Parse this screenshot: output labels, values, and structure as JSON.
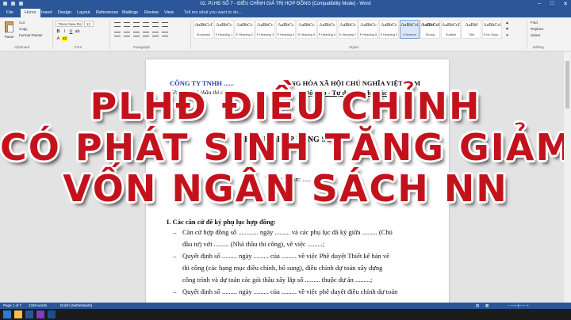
{
  "window": {
    "title": "02. PLHĐ SỐ 7 - ĐIỀU CHỈNH GIÁ TRỊ HỢP ĐỒNG [Compatibility Mode] - Word"
  },
  "ribbon_tabs": [
    "File",
    "Home",
    "Insert",
    "Design",
    "Layout",
    "References",
    "Mailings",
    "Review",
    "View"
  ],
  "active_tab": "Home",
  "tell_me": "Tell me what you want to do...",
  "clipboard": {
    "paste": "Paste",
    "cut": "Cut",
    "copy": "Copy",
    "format_painter": "Format Painter",
    "group": "Clipboard"
  },
  "font": {
    "name": "Times New Ro",
    "size": "12",
    "group": "Font"
  },
  "paragraph": {
    "group": "Paragraph"
  },
  "styles": {
    "group": "Styles",
    "items": [
      {
        "sample": "AaBbCcI",
        "name": "Emphasis"
      },
      {
        "sample": "AaBbCc",
        "name": "¶ Heading 1"
      },
      {
        "sample": "AaBbCc",
        "name": "¶ Heading 2"
      },
      {
        "sample": "AaBbCc",
        "name": "¶ Heading 3"
      },
      {
        "sample": "AaBbCc",
        "name": "¶ Heading 4"
      },
      {
        "sample": "AaBbCc",
        "name": "¶ Heading 5"
      },
      {
        "sample": "AaBbCc",
        "name": "¶ Heading 6"
      },
      {
        "sample": "AaBbCc",
        "name": "¶ Heading 7"
      },
      {
        "sample": "AaBbCc",
        "name": "¶ Heading 8"
      },
      {
        "sample": "AaBbCc",
        "name": "¶ Heading 9"
      },
      {
        "sample": "AaBbCcl",
        "name": "¶ Normal"
      },
      {
        "sample": "AaBbCcI",
        "name": "Strong"
      },
      {
        "sample": "AaBbCcD",
        "name": "Subtitle"
      },
      {
        "sample": "AaBbI",
        "name": "Title"
      },
      {
        "sample": "AaBbCcl",
        "name": "¶ No Spac..."
      }
    ]
  },
  "editing": {
    "find": "Find",
    "replace": "Replace",
    "select": "Select",
    "group": "Editing"
  },
  "document": {
    "company": "CÔNG TY TNHH ......",
    "company_sub": "(Ghi tên Nhà thầu thi công)",
    "nation": "CỘNG HÒA XÃ HỘI CHỦ NGHĨA VIỆT NAM",
    "motto": "Độc lập - Tự do - Hạnh phúc",
    "annex_title_prefix": "PHỤ LỤC HỢP ĐỒNG SỐ",
    "annex_number": "01",
    "project_line": "Thuộc dự án: .....",
    "section_heading": "I. Các căn cứ để ký phụ lục hợp đồng:",
    "lines": [
      {
        "lead": "–",
        "text": "Căn cứ hợp đồng số ............ ngày ......... và các phụ lục đã ký giữa ......... (Chủ"
      },
      {
        "lead": "",
        "text": "đầu tư) với ......... (Nhà thầu thi công), về việc .........;"
      },
      {
        "lead": "–",
        "text": "Quyết định số ......... ngày ......... của ......... về việc Phê duyệt Thiết kế bản vẽ"
      },
      {
        "lead": "",
        "text": "thi công (các hạng mục điều chỉnh, bổ sung), điều chỉnh dự toán xây dựng"
      },
      {
        "lead": "",
        "text": "công trình và dự toán các gói thầu xây lắp số ......... thuộc dự án .........;"
      },
      {
        "lead": "–",
        "text": "Quyết định số ......... ngày ......... của ......... về việc phê duyệt điều chỉnh dự toán"
      }
    ]
  },
  "overlay": {
    "line1": "PLHĐ ĐIỀU CHỈNH",
    "line2": "CÓ PHÁT SINH TĂNG GIẢM",
    "line3": "VỐN NGÂN SÁCH NN"
  },
  "status": {
    "page": "Page 1 of 7",
    "words": "1348 words",
    "language": "Dutch (Netherlands)"
  },
  "colors": {
    "word_blue": "#2b579a",
    "overlay_red": "#c4121d",
    "doc_blue": "#1f3bb3"
  }
}
